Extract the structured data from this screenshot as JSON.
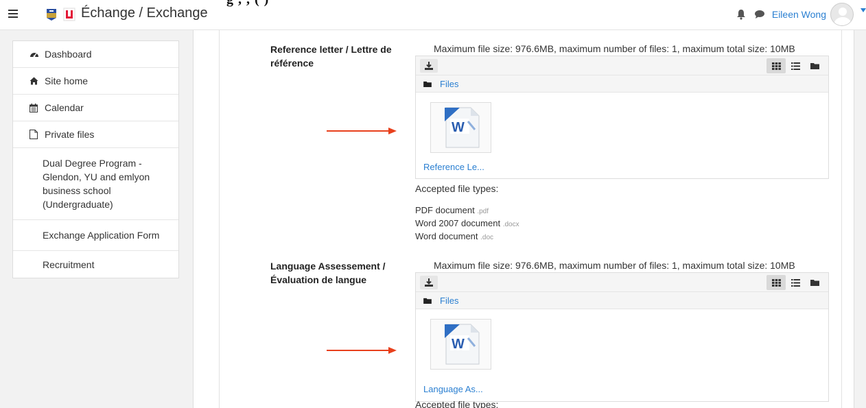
{
  "header": {
    "title": "Échange / Exchange",
    "user_name": "Eileen Wong"
  },
  "annotation": {
    "strip_text": "g        ,        ,                                          (                   )"
  },
  "sidebar": {
    "items": [
      {
        "label": "Dashboard",
        "icon": "dashboard-icon"
      },
      {
        "label": "Site home",
        "icon": "home-icon"
      },
      {
        "label": "Calendar",
        "icon": "calendar-icon"
      },
      {
        "label": "Private files",
        "icon": "file-icon"
      },
      {
        "label": "Dual Degree Program - Glendon, YU and emlyon business school (Undergraduate)"
      },
      {
        "label": "Exchange Application Form"
      },
      {
        "label": "Recruitment"
      }
    ]
  },
  "uploads": [
    {
      "label": "Reference letter / Lettre de référence",
      "limits": "Maximum file size: 976.6MB, maximum number of files: 1, maximum total size: 10MB",
      "path_label": "Files",
      "file_name": "Reference Le...",
      "accepted_label": "Accepted file types:",
      "types": [
        {
          "name": "PDF document",
          "ext": ".pdf"
        },
        {
          "name": "Word 2007 document",
          "ext": ".docx"
        },
        {
          "name": "Word document",
          "ext": ".doc"
        }
      ]
    },
    {
      "label": "Language Assessement / Évaluation de langue",
      "limits": "Maximum file size: 976.6MB, maximum number of files: 1, maximum total size: 10MB",
      "path_label": "Files",
      "file_name": "Language As...",
      "accepted_label": "Accepted file types:"
    }
  ],
  "colors": {
    "link": "#2a7fd1",
    "annotation_strip": "#19f0f4",
    "arrow": "#e8401c"
  }
}
